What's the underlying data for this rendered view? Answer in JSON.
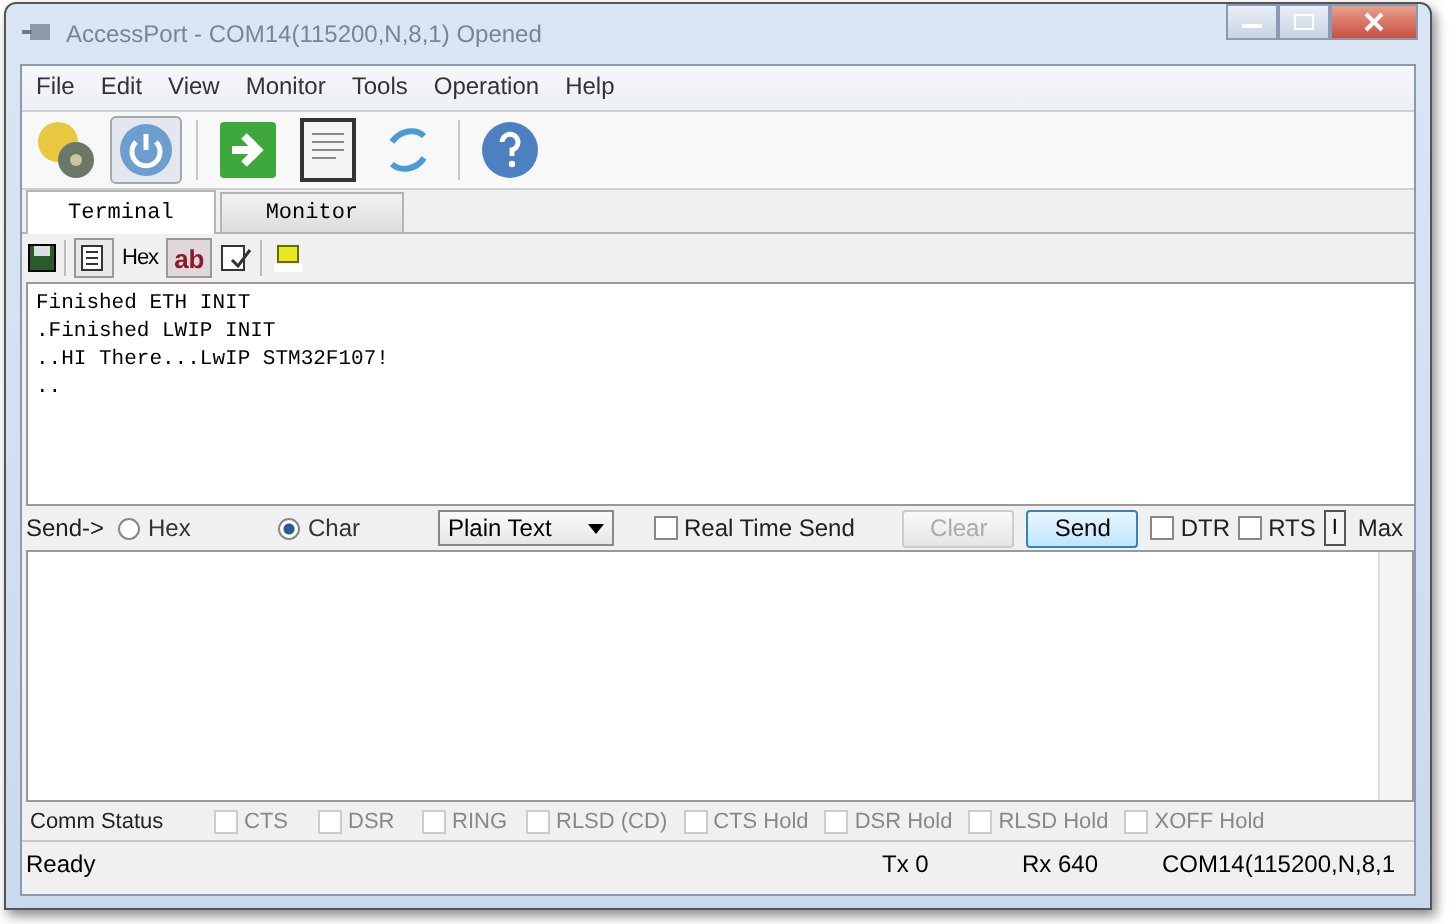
{
  "window": {
    "title": "AccessPort - COM14(115200,N,8,1) Opened"
  },
  "menu": [
    "File",
    "Edit",
    "View",
    "Monitor",
    "Tools",
    "Operation",
    "Help"
  ],
  "tabs": [
    {
      "label": "Terminal",
      "selected": true
    },
    {
      "label": "Monitor",
      "selected": false
    }
  ],
  "sub_toolbar": {
    "hex_label": "Hex",
    "ab_label": "ab",
    "ab_pressed": true
  },
  "terminal_lines": [
    "Finished ETH INIT",
    ".Finished LWIP INIT",
    "..HI There...LwIP STM32F107!",
    ".."
  ],
  "send_bar": {
    "label": "Send->",
    "radios": [
      {
        "label": "Hex",
        "selected": false
      },
      {
        "label": "Char",
        "selected": true
      }
    ],
    "format": "Plain Text",
    "real_time": {
      "label": "Real Time Send",
      "checked": false
    },
    "clear": {
      "label": "Clear",
      "disabled": true
    },
    "send": {
      "label": "Send",
      "disabled": false
    },
    "lines": [
      {
        "label": "DTR",
        "checked": false
      },
      {
        "label": "RTS",
        "checked": false
      }
    ],
    "pipe": "I",
    "max": "Max"
  },
  "comm_status": {
    "label": "Comm Status",
    "items": [
      {
        "label": "CTS",
        "checked": false,
        "disabled": true
      },
      {
        "label": "DSR",
        "checked": false,
        "disabled": true
      },
      {
        "label": "RING",
        "checked": false,
        "disabled": true
      },
      {
        "label": "RLSD (CD)",
        "checked": false,
        "disabled": true
      },
      {
        "label": "CTS Hold",
        "checked": false,
        "disabled": true
      },
      {
        "label": "DSR Hold",
        "checked": false,
        "disabled": true
      },
      {
        "label": "RLSD Hold",
        "checked": false,
        "disabled": true
      },
      {
        "label": "XOFF Hold",
        "checked": false,
        "disabled": true
      }
    ]
  },
  "status_bar": {
    "state": "Ready",
    "tx": "Tx 0",
    "rx": "Rx 640",
    "port": "COM14(115200,N,8,1"
  }
}
